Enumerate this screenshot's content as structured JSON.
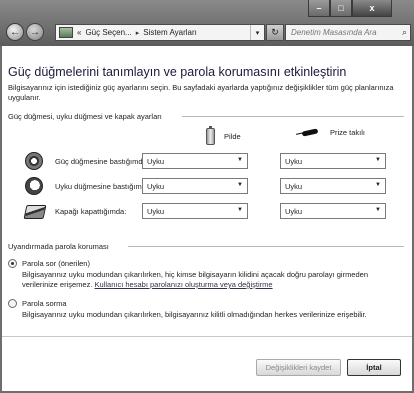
{
  "window": {
    "min_label": "–",
    "max_label": "□",
    "close_label": "x"
  },
  "nav": {
    "back_icon": "←",
    "forward_icon": "→",
    "dropdown_icon": "▾"
  },
  "address": {
    "prefix": "«",
    "crumbs": [
      "Güç Seçen...",
      "Sistem Ayarları"
    ],
    "separator": "▸",
    "dropdown_icon": "▾",
    "refresh_icon": "↻"
  },
  "search": {
    "placeholder": "Denetim Masasında Ara",
    "icon": "⌕"
  },
  "page": {
    "title": "Güç düğmelerini tanımlayın ve parola korumasını etkinleştirin",
    "description": "Bilgisayarınız için istediğiniz güç ayarlarını seçin. Bu sayfadaki ayarlarda yaptığınız değişiklikler tüm güç planlarınıza uygulanır."
  },
  "buttons_group": {
    "header": "Güç düğmesi, uyku düğmesi ve kapak ayarları",
    "col_battery": "Pilde",
    "col_plugged": "Prize takılı",
    "rows": [
      {
        "label": "Güç düğmesine bastığımda:",
        "battery": "Uyku",
        "plugged": "Uyku"
      },
      {
        "label": "Uyku düğmesine bastığımda:",
        "battery": "Uyku",
        "plugged": "Uyku"
      },
      {
        "label": "Kapağı kapattığımda:",
        "battery": "Uyku",
        "plugged": "Uyku"
      }
    ],
    "select_arrow": "▼"
  },
  "password_group": {
    "header": "Uyandırmada parola koruması",
    "option1": {
      "label": "Parola sor (önerilen)",
      "desc": "Bilgisayarınız uyku modundan çıkarılırken, hiç kimse bilgisayarın kilidini açacak doğru parolayı girmeden verilerinize erişemez.",
      "link": "Kullanıcı hesabı parolanızı oluşturma veya değiştirme",
      "selected": true
    },
    "option2": {
      "label": "Parola sorma",
      "desc": "Bilgisayarınız uyku modundan çıkarılırken, bilgisayarınız kilitli olmadığından herkes verilerinize erişebilir.",
      "selected": false
    }
  },
  "footer": {
    "save_label": "Değişiklikleri kaydet",
    "cancel_label": "İptal"
  }
}
